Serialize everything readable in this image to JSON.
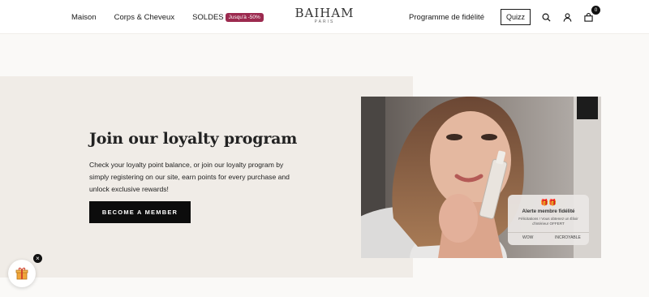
{
  "header": {
    "nav": [
      {
        "label": "Maison"
      },
      {
        "label": "Corps & Cheveux"
      },
      {
        "label": "SOLDES",
        "badge": "Jusqu'à -50%"
      }
    ],
    "logo": {
      "main": "BAIHAM",
      "sub": "PARIS"
    },
    "loyalty_link": "Programme de fidélité",
    "quizz_label": "Quizz",
    "cart_count": "0",
    "icons": [
      "search-icon",
      "account-icon",
      "cart-icon"
    ]
  },
  "hero": {
    "title": "Join our loyalty program",
    "description": "Check your loyalty point balance, or join our loyalty program by simply registering on our site, earn points for every purchase and unlock exclusive rewards!",
    "cta_label": "BECOME A MEMBER"
  },
  "notification": {
    "emoji": "🎁🎁",
    "title": "Alerte membre fidélité",
    "body": "Félicitations ! Vous obtenez un Élixir d'intérieur OFFERT",
    "button_left": "WOW",
    "button_right": "INCROYABLE"
  },
  "colors": {
    "badge": "#9c2a4f",
    "cta": "#0c0c0c",
    "hero_bg": "#f0ece7"
  }
}
